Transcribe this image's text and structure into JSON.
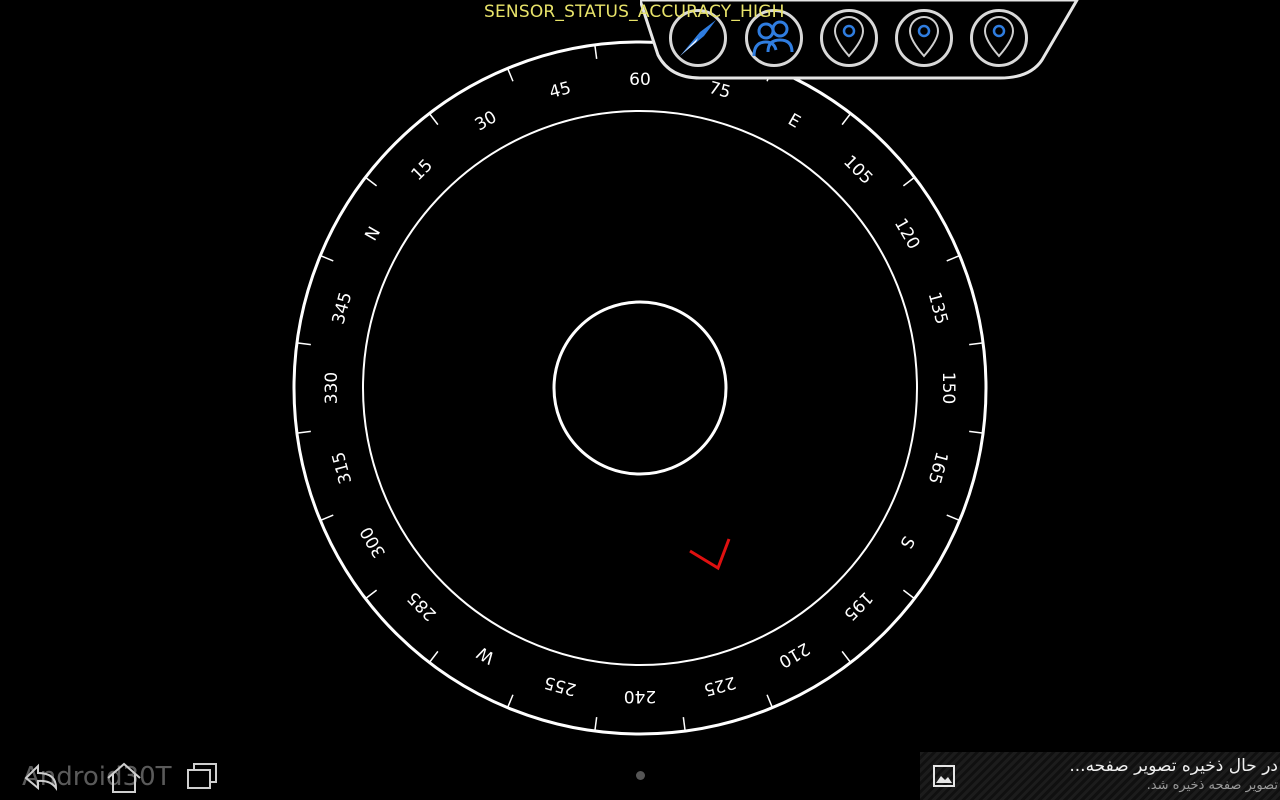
{
  "status_text": "SENSOR_STATUS_ACCURACY_HIGH",
  "compass": {
    "labels": [
      "N",
      "15",
      "30",
      "45",
      "60",
      "75",
      "E",
      "105",
      "120",
      "135",
      "150",
      "165",
      "S",
      "195",
      "210",
      "225",
      "240",
      "255",
      "W",
      "285",
      "300",
      "315",
      "330",
      "345"
    ],
    "rotation_offset_deg": -60,
    "heading_marker_color": "#e01010"
  },
  "toolbar": {
    "buttons": [
      {
        "icon": "compass-needle-icon",
        "active": true
      },
      {
        "icon": "people-icon",
        "active": true
      },
      {
        "icon": "location-pin-icon",
        "active": false
      },
      {
        "icon": "location-pin-icon",
        "active": false
      },
      {
        "icon": "location-pin-icon",
        "active": false
      }
    ],
    "accent_color": "#2f7de0"
  },
  "navbar": {
    "back_icon": "back-icon",
    "home_icon": "home-icon",
    "recents_icon": "recent-apps-icon",
    "watermark": "Android30T"
  },
  "notification": {
    "icon": "image-icon",
    "title": "در حال ذخیره تصویر صفحه...",
    "subtitle": "تصویر صفحه ذخیره شد."
  }
}
